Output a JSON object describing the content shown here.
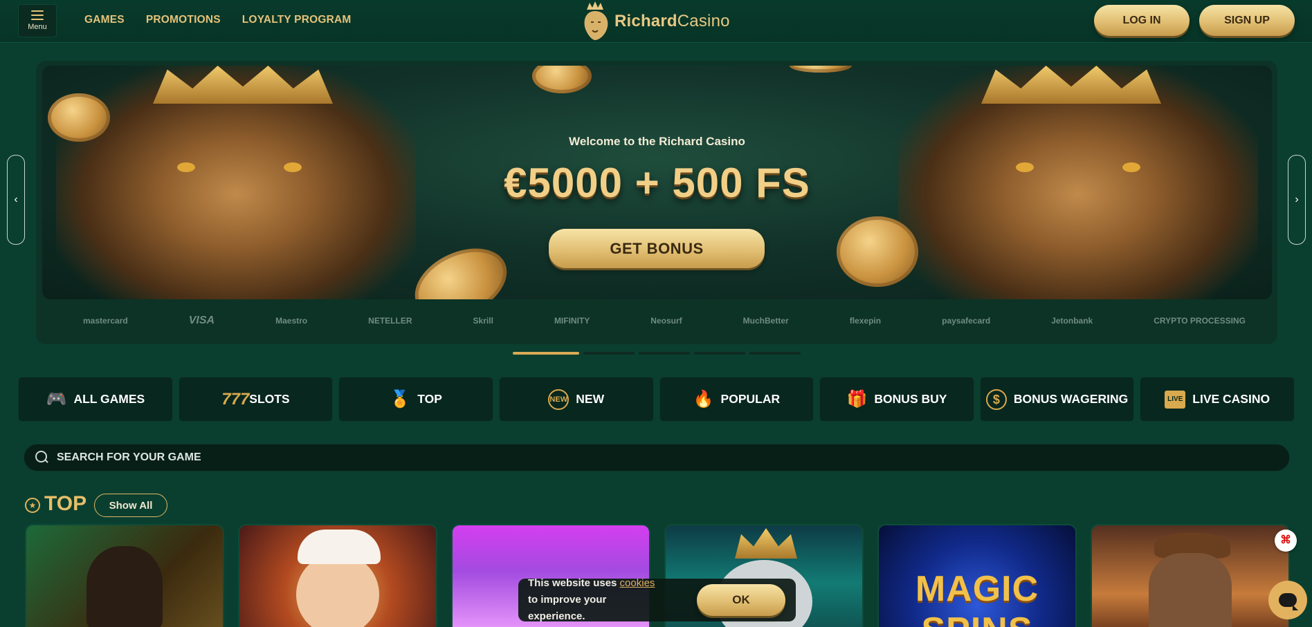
{
  "header": {
    "menu_label": "Menu",
    "nav": [
      "GAMES",
      "PROMOTIONS",
      "LOYALTY PROGRAM"
    ],
    "logo_bold": "Richard",
    "logo_light": "Casino",
    "login_label": "LOG IN",
    "signup_label": "SIGN UP"
  },
  "hero": {
    "subtitle": "Welcome to the Richard Casino",
    "title": "€5000 + 500 FS",
    "cta_label": "GET BONUS",
    "prev_icon": "‹",
    "next_icon": "›",
    "slides_total": 5,
    "active_slide": 1
  },
  "payments": [
    "mastercard",
    "VISA",
    "Maestro",
    "NETELLER",
    "Skrill",
    "MIFINITY",
    "Neosurf",
    "MuchBetter",
    "flexepin",
    "paysafecard",
    "Jetonbank",
    "CRYPTO PROCESSING"
  ],
  "categories": [
    {
      "label": "ALL GAMES",
      "icon": "gamepad-icon",
      "glyph": "🎮"
    },
    {
      "label": "SLOTS",
      "icon": "slots-777-icon",
      "glyph": "7"
    },
    {
      "label": "TOP",
      "icon": "medal-icon",
      "glyph": "🏅"
    },
    {
      "label": "NEW",
      "icon": "new-badge-icon",
      "glyph": "✦"
    },
    {
      "label": "POPULAR",
      "icon": "flame-icon",
      "glyph": "🔥"
    },
    {
      "label": "BONUS BUY",
      "icon": "gift-icon",
      "glyph": "🎁"
    },
    {
      "label": "BONUS WAGERING",
      "icon": "dollar-cycle-icon",
      "glyph": "$"
    },
    {
      "label": "LIVE CASINO",
      "icon": "live-icon",
      "glyph": "▣"
    }
  ],
  "search": {
    "placeholder": "SEARCH FOR YOUR GAME"
  },
  "top_section": {
    "title": "TOP",
    "show_all_label": "Show All"
  },
  "games": [
    {
      "art": "snoop-dogg-dollars"
    },
    {
      "art": "chef-character"
    },
    {
      "art": "purple-egg"
    },
    {
      "art": "crowned-king"
    },
    {
      "title": "MAGIC SPINS"
    },
    {
      "art": "cowboy-adventurer"
    }
  ],
  "cookie": {
    "text_before": "This website uses ",
    "link": "cookies",
    "text_after": " to improve your experience.",
    "ok_label": "OK"
  },
  "colors": {
    "accent": "#e2b25e",
    "background": "#0a3f2f",
    "panel": "#08271e"
  }
}
